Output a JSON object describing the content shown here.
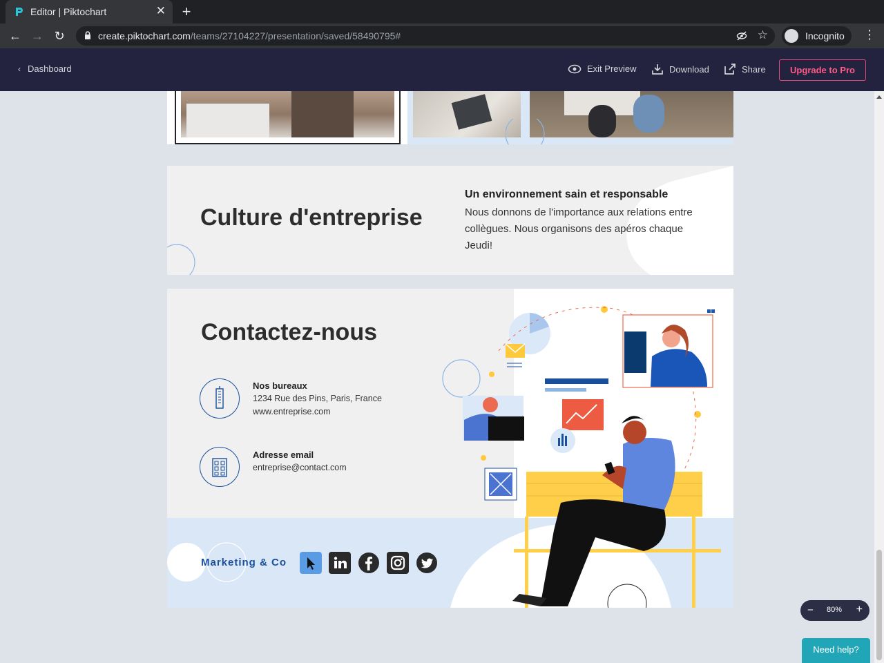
{
  "browser": {
    "tab_title": "Editor | Piktochart",
    "url_host": "create.piktochart.com",
    "url_path": "/teams/27104227/presentation/saved/58490795#",
    "profile": "Incognito"
  },
  "header": {
    "back_label": "Dashboard",
    "exit_preview": "Exit Preview",
    "download": "Download",
    "share": "Share",
    "upgrade": "Upgrade to Pro"
  },
  "culture": {
    "title": "Culture d'entreprise",
    "heading": "Un environnement sain et responsable",
    "body": "Nous donnons de l'importance aux relations entre collègues. Nous organisons des apéros chaque Jeudi!"
  },
  "contact": {
    "title": "Contactez-nous",
    "office_heading": "Nos bureaux",
    "office_address": "1234 Rue des Pins, Paris, France",
    "office_web": "www.entreprise.com",
    "email_heading": "Adresse email",
    "email_value": "entreprise@contact.com",
    "brand": "Marketing & Co",
    "socials": [
      "cursor-icon",
      "linkedin-icon",
      "facebook-icon",
      "instagram-icon",
      "twitter-icon"
    ]
  },
  "zoom": {
    "minus": "−",
    "value": "80%",
    "plus": "+"
  },
  "help": "Need help?",
  "colors": {
    "header_bg": "#23233f",
    "accent_pink": "#e8467c",
    "brand_blue": "#1a4f9c",
    "help_teal": "#20a6b6"
  }
}
